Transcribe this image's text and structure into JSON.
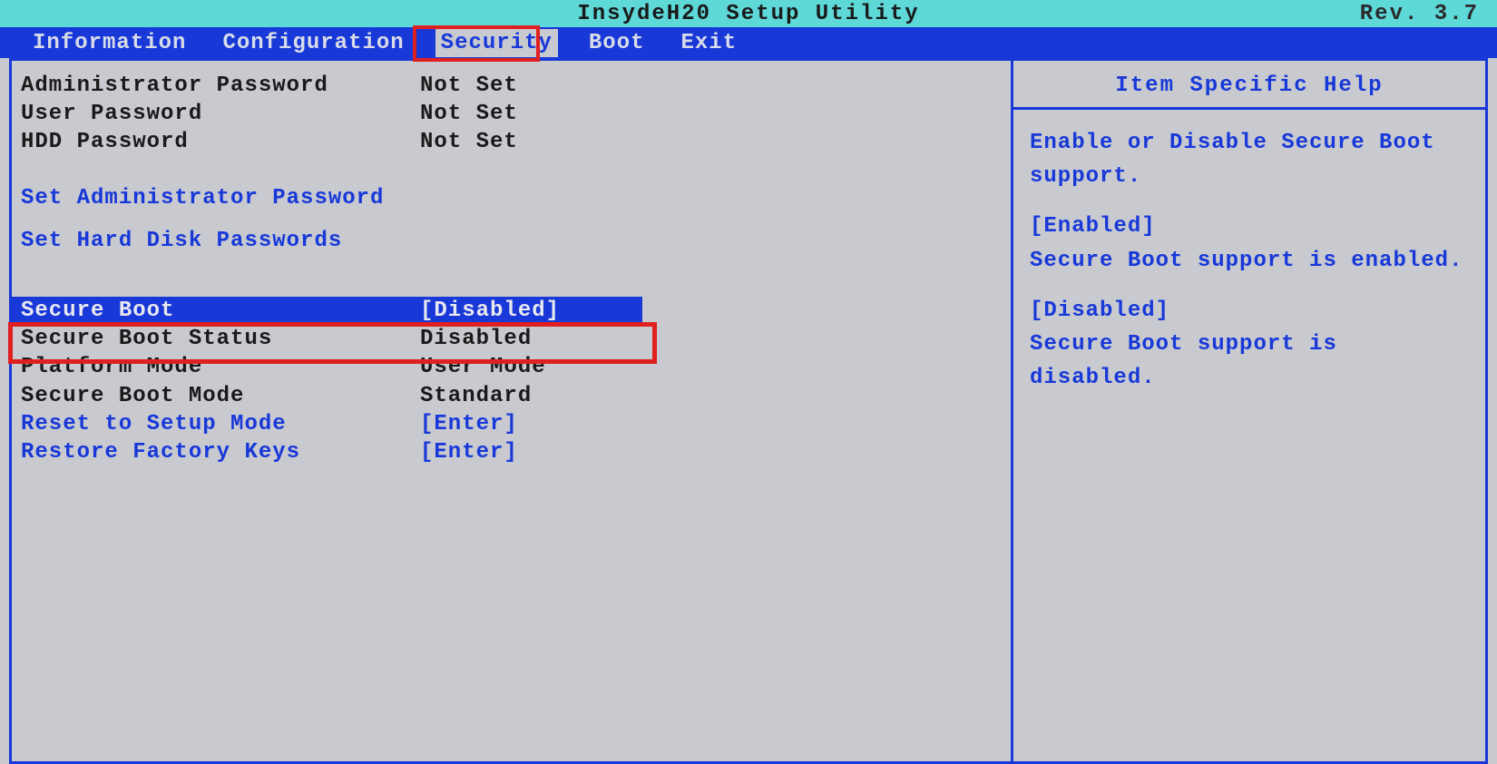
{
  "header": {
    "title": "InsydeH20 Setup Utility",
    "revision": "Rev. 3.7"
  },
  "menu": {
    "items": [
      {
        "label": "Information"
      },
      {
        "label": "Configuration"
      },
      {
        "label": "Security",
        "active": true
      },
      {
        "label": "Boot"
      },
      {
        "label": "Exit"
      }
    ]
  },
  "security": {
    "admin_password_label": "Administrator Password",
    "admin_password_value": "Not Set",
    "user_password_label": "User Password",
    "user_password_value": "Not Set",
    "hdd_password_label": "HDD Password",
    "hdd_password_value": "Not Set",
    "set_admin_password": "Set Administrator Password",
    "set_hdd_passwords": "Set Hard Disk Passwords",
    "secure_boot_label": "Secure Boot",
    "secure_boot_value": "[Disabled]",
    "secure_boot_status_label": "Secure Boot Status",
    "secure_boot_status_value": "Disabled",
    "platform_mode_label": "Platform Mode",
    "platform_mode_value": "User Mode",
    "secure_boot_mode_label": "Secure Boot Mode",
    "secure_boot_mode_value": "Standard",
    "reset_setup_mode_label": "Reset to Setup Mode",
    "reset_setup_mode_value": "[Enter]",
    "restore_factory_keys_label": "Restore Factory Keys",
    "restore_factory_keys_value": "[Enter]"
  },
  "help": {
    "title": "Item Specific Help",
    "summary": "Enable or Disable Secure Boot support.",
    "enabled_label": "[Enabled]",
    "enabled_desc": "Secure Boot support is enabled.",
    "disabled_label": "[Disabled]",
    "disabled_desc": "Secure Boot support is disabled."
  }
}
